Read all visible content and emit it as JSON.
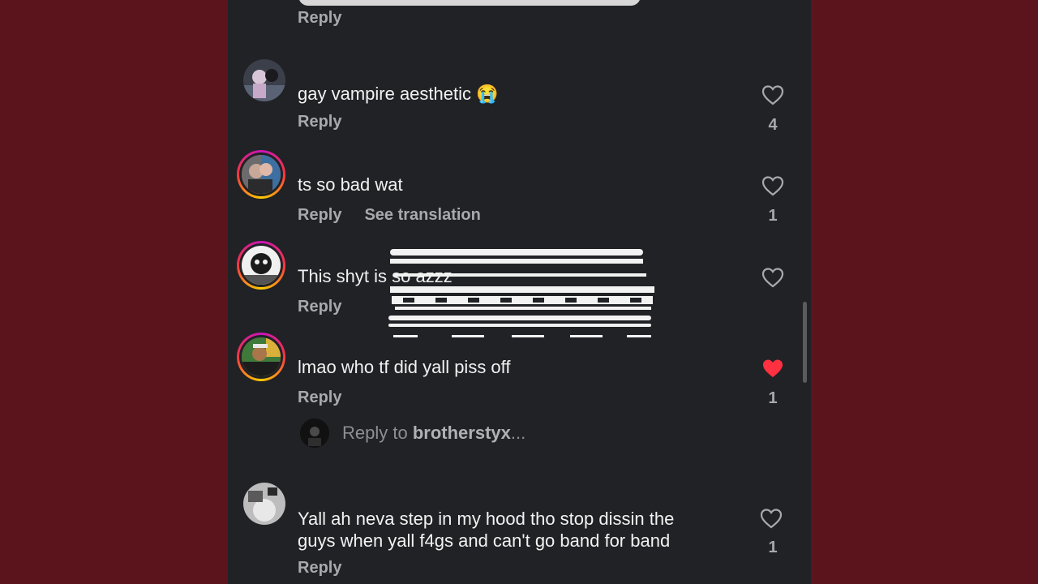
{
  "top": {
    "reply_label": "Reply"
  },
  "comments": [
    {
      "text": "gay vampire aesthetic 😭",
      "reply_label": "Reply",
      "likes": "4",
      "liked": false
    },
    {
      "text": "ts so bad wat",
      "reply_label": "Reply",
      "see_translation": "See translation",
      "likes": "1",
      "liked": false
    },
    {
      "text": "This shyt is so azzz",
      "reply_label": "Reply",
      "liked": false
    },
    {
      "text": "lmao who tf did yall piss off",
      "reply_label": "Reply",
      "likes": "1",
      "liked": true
    },
    {
      "text_lines": [
        "Yall ah neva step in my hood tho stop dissin the",
        "guys when yall f4gs and can't go band for band"
      ],
      "reply_label": "Reply",
      "likes": "1",
      "liked": false
    }
  ],
  "reply_input": {
    "prefix": "Reply to",
    "username": "brotherstyx",
    "suffix": "..."
  },
  "colors": {
    "background": "#5c141c",
    "panel": "#212226",
    "liked": "#ff3040"
  }
}
